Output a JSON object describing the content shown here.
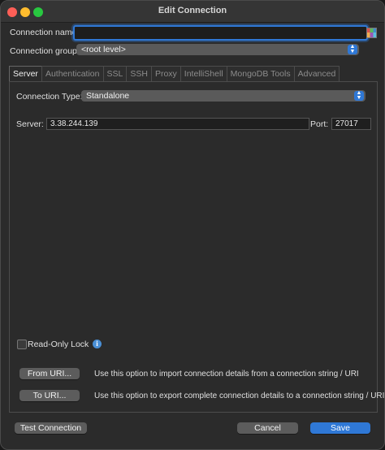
{
  "window": {
    "title": "Edit Connection"
  },
  "connection": {
    "name_label": "Connection name:",
    "name_value": "",
    "group_label": "Connection group:",
    "group_value": "<root level>"
  },
  "tabs": [
    {
      "label": "Server",
      "active": true
    },
    {
      "label": "Authentication",
      "active": false
    },
    {
      "label": "SSL",
      "active": false
    },
    {
      "label": "SSH",
      "active": false
    },
    {
      "label": "Proxy",
      "active": false
    },
    {
      "label": "IntelliShell",
      "active": false
    },
    {
      "label": "MongoDB Tools",
      "active": false
    },
    {
      "label": "Advanced",
      "active": false
    }
  ],
  "server_tab": {
    "type_label": "Connection Type:",
    "type_value": "Standalone",
    "server_label": "Server:",
    "server_value": "3.38.244.139",
    "port_label": "Port:",
    "port_value": "27017",
    "readonly_label": "Read-Only Lock",
    "readonly_checked": false,
    "info_glyph": "i"
  },
  "uri": {
    "from_button": "From URI...",
    "from_desc": "Use this option to import connection details from a connection string / URI",
    "to_button": "To URI...",
    "to_desc": "Use this option to export complete connection details to a connection string / URI"
  },
  "footer": {
    "test_button": "Test Connection",
    "cancel_button": "Cancel",
    "save_button": "Save"
  },
  "colors": {
    "accent": "#2f78d6",
    "background": "#2b2b2b"
  }
}
